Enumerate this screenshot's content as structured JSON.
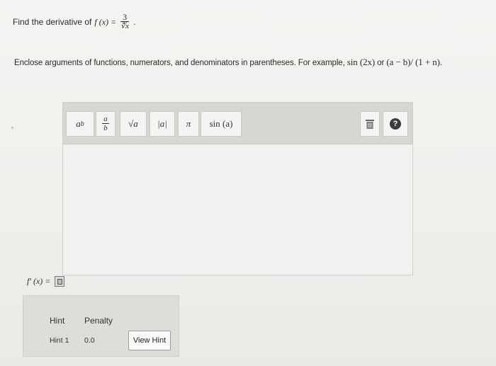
{
  "question": {
    "prefix": "Find the derivative of",
    "func": "f (x) =",
    "numerator": "3",
    "denominator": "∜x",
    "suffix": "."
  },
  "instructions": {
    "text": "Enclose arguments of functions, numerators, and denominators in parentheses. For example,",
    "example1": "sin (2x)",
    "or": "or",
    "example2": "(a − b)/ (1 + n)."
  },
  "toolbar": {
    "power": {
      "base": "a",
      "exp": "b"
    },
    "fraction": {
      "num": "a",
      "den": "b"
    },
    "sqrt": "√a",
    "abs": "|a|",
    "pi": "π",
    "sin": "sin (a)",
    "help": "?"
  },
  "answer": {
    "label": "f′ (x) ="
  },
  "hints": {
    "headers": [
      "Hint",
      "Penalty"
    ],
    "rows": [
      {
        "hint": "Hint 1",
        "penalty": "0.0",
        "button": "View Hint"
      }
    ]
  }
}
